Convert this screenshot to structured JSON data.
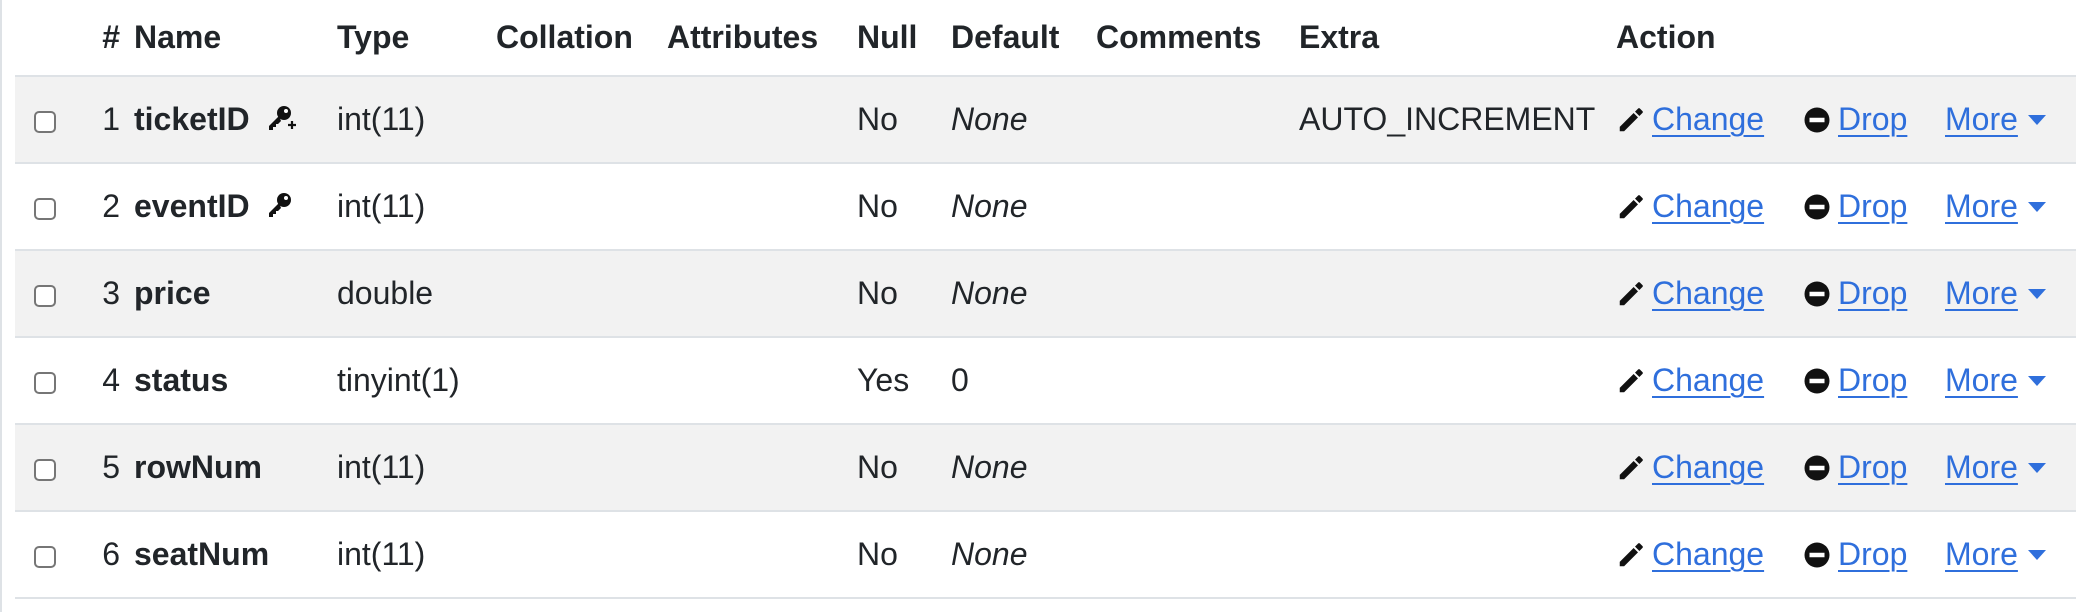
{
  "columns": {
    "num": "#",
    "name": "Name",
    "type": "Type",
    "collation": "Collation",
    "attributes": "Attributes",
    "null": "Null",
    "default": "Default",
    "comments": "Comments",
    "extra": "Extra",
    "action": "Action"
  },
  "actions": {
    "change": "Change",
    "drop": "Drop",
    "more": "More"
  },
  "icons": {
    "primary_key": "primary-key-icon",
    "index_key": "key-icon",
    "change": "pencil-icon",
    "drop": "minus-circle-icon",
    "more": "caret-down-icon"
  },
  "colors": {
    "link": "#2f6fdc",
    "stripe": "#f2f2f2",
    "border": "#dee2e6"
  },
  "rows": [
    {
      "num": "1",
      "name": "ticketID",
      "key": "primary",
      "type": "int(11)",
      "collation": "",
      "attributes": "",
      "null": "No",
      "default": "None",
      "comments": "",
      "extra": "AUTO_INCREMENT"
    },
    {
      "num": "2",
      "name": "eventID",
      "key": "index",
      "type": "int(11)",
      "collation": "",
      "attributes": "",
      "null": "No",
      "default": "None",
      "comments": "",
      "extra": ""
    },
    {
      "num": "3",
      "name": "price",
      "key": "",
      "type": "double",
      "collation": "",
      "attributes": "",
      "null": "No",
      "default": "None",
      "comments": "",
      "extra": ""
    },
    {
      "num": "4",
      "name": "status",
      "key": "",
      "type": "tinyint(1)",
      "collation": "",
      "attributes": "",
      "null": "Yes",
      "default": "0",
      "comments": "",
      "extra": ""
    },
    {
      "num": "5",
      "name": "rowNum",
      "key": "",
      "type": "int(11)",
      "collation": "",
      "attributes": "",
      "null": "No",
      "default": "None",
      "comments": "",
      "extra": ""
    },
    {
      "num": "6",
      "name": "seatNum",
      "key": "",
      "type": "int(11)",
      "collation": "",
      "attributes": "",
      "null": "No",
      "default": "None",
      "comments": "",
      "extra": ""
    }
  ]
}
